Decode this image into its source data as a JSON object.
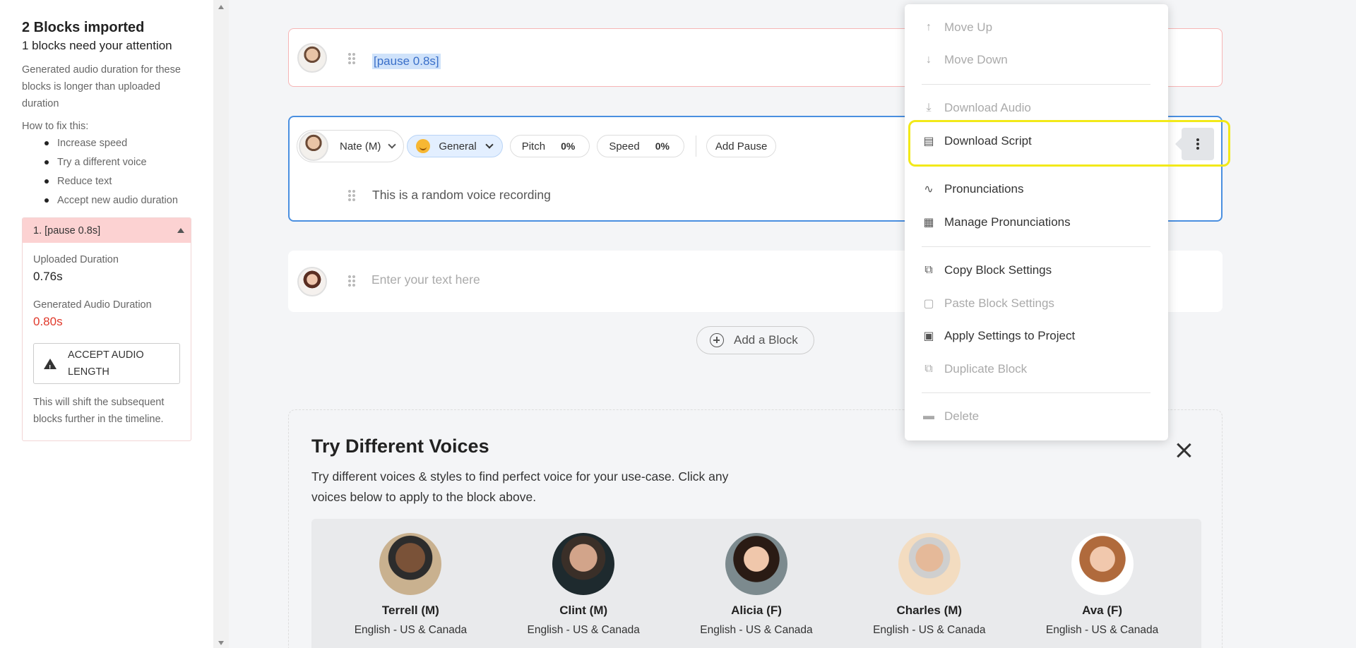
{
  "sidebar": {
    "title": "2 Blocks imported",
    "subtitle": "1 blocks need your attention",
    "description": "Generated audio duration for these blocks is longer than uploaded duration",
    "how_to_fix": "How to fix this:",
    "fixes": [
      "Increase speed",
      "Try a different voice",
      "Reduce text",
      "Accept new audio duration"
    ],
    "card": {
      "header": "1. [pause 0.8s]",
      "uploaded_label": "Uploaded Duration",
      "uploaded_value": "0.76s",
      "generated_label": "Generated Audio Duration",
      "generated_value": "0.80s",
      "accept_button": "ACCEPT AUDIO LENGTH",
      "note": "This will shift the subsequent blocks further in the timeline."
    }
  },
  "blocks": [
    {
      "text": "[pause 0.8s]"
    },
    {
      "voice": "Nate (M)",
      "style": "General",
      "pitch_label": "Pitch",
      "pitch_value": "0%",
      "speed_label": "Speed",
      "speed_value": "0%",
      "add_pause": "Add Pause",
      "text": "This is a random voice recording"
    },
    {
      "placeholder": "Enter your text here"
    }
  ],
  "add_block": "Add a Block",
  "try_voices": {
    "title": "Try Different Voices",
    "description": "Try different voices & styles to find perfect voice for your use-case. Click any voices below to apply to the block above.",
    "voices": [
      {
        "name": "Terrell (M)",
        "lang": "English - US & Canada"
      },
      {
        "name": "Clint (M)",
        "lang": "English - US & Canada"
      },
      {
        "name": "Alicia (F)",
        "lang": "English - US & Canada"
      },
      {
        "name": "Charles (M)",
        "lang": "English - US & Canada"
      },
      {
        "name": "Ava (F)",
        "lang": "English - US & Canada"
      }
    ]
  },
  "menu": {
    "move_up": "Move Up",
    "move_down": "Move Down",
    "download_audio": "Download Audio",
    "download_script": "Download Script",
    "pronunciations": "Pronunciations",
    "manage_pronunciations": "Manage Pronunciations",
    "copy_settings": "Copy Block Settings",
    "paste_settings": "Paste Block Settings",
    "apply_settings": "Apply Settings to Project",
    "duplicate": "Duplicate Block",
    "delete": "Delete"
  },
  "colors": {
    "accent": "#4a8fe0",
    "error": "#e0392b",
    "highlight": "#f2e919"
  }
}
